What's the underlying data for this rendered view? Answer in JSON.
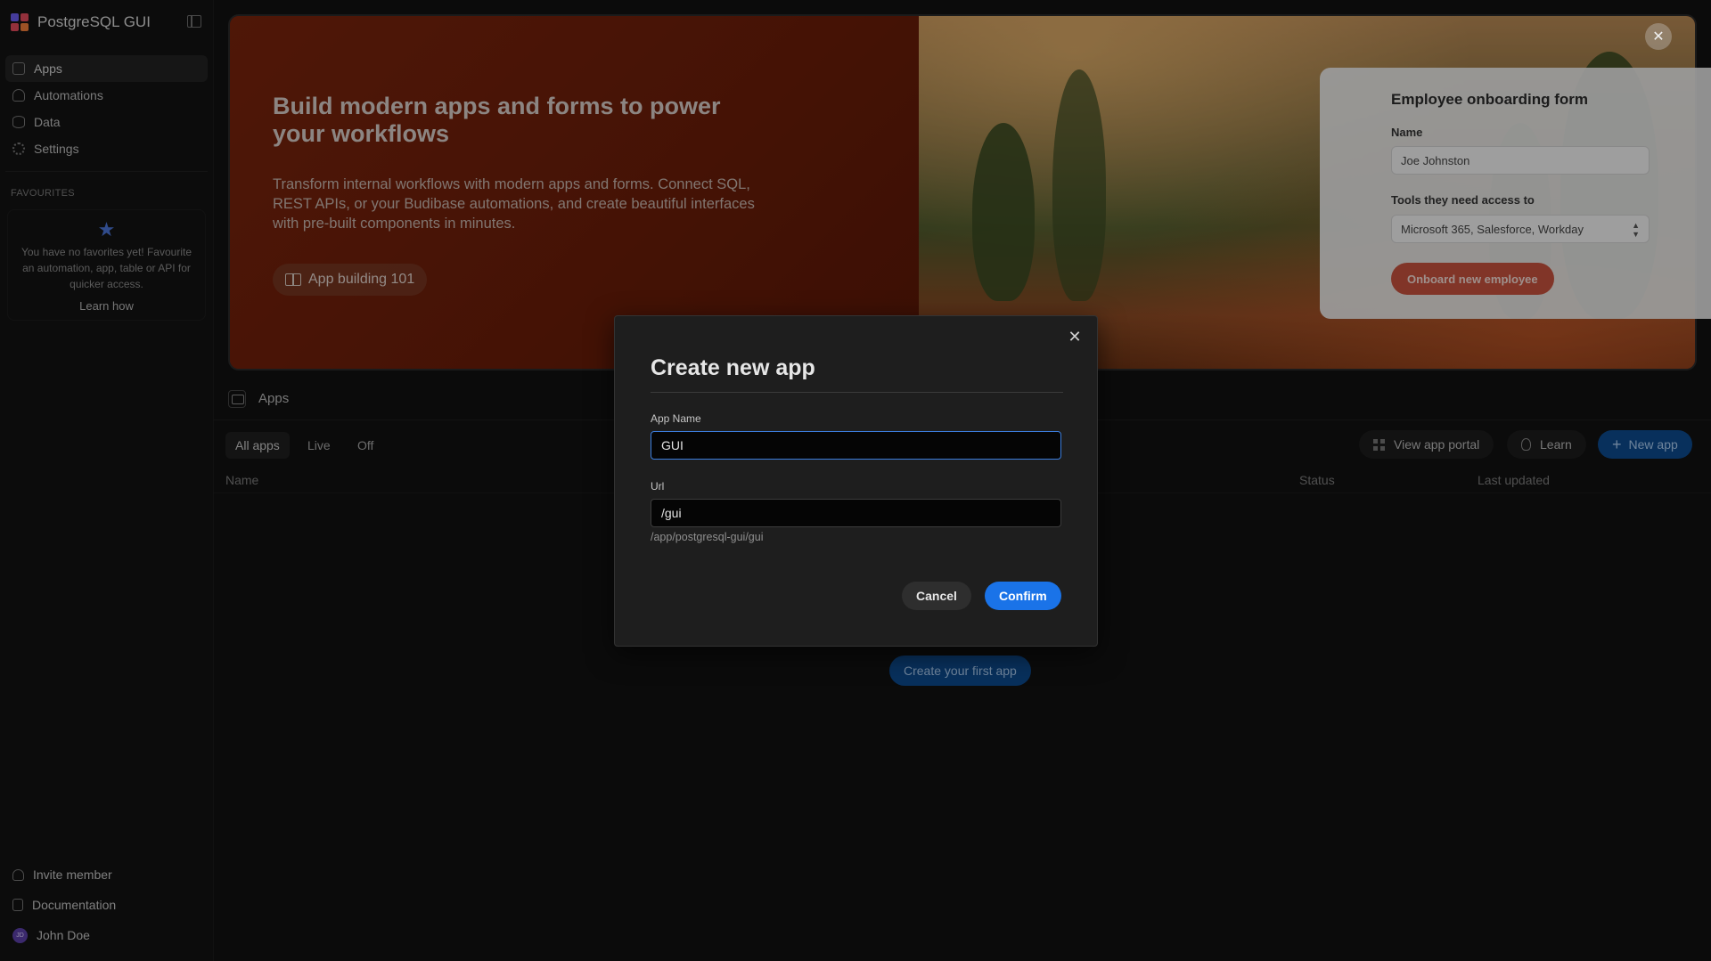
{
  "sidebar": {
    "title": "PostgreSQL GUI",
    "nav": [
      {
        "label": "Apps",
        "icon": "apps-icon"
      },
      {
        "label": "Automations",
        "icon": "automations-icon"
      },
      {
        "label": "Data",
        "icon": "database-icon"
      },
      {
        "label": "Settings",
        "icon": "gear-icon"
      }
    ],
    "favourites_heading": "FAVOURITES",
    "favourites_empty": "You have no favorites yet! Favourite an automation, app, table or API for quicker access.",
    "learn_how": "Learn how",
    "bottom": [
      {
        "label": "Invite member"
      },
      {
        "label": "Documentation"
      },
      {
        "label": "John Doe",
        "avatar": "JD"
      }
    ]
  },
  "hero": {
    "title": "Build modern apps and forms to power your workflows",
    "description": "Transform internal workflows with modern apps and forms. Connect SQL, REST APIs, or your Budibase automations, and create beautiful interfaces with pre-built components in minutes.",
    "button": "App building 101",
    "form": {
      "title": "Employee onboarding form",
      "name_label": "Name",
      "name_value": "Joe Johnston",
      "tools_label": "Tools they need access to",
      "tools_value": "Microsoft 365, Salesforce, Workday",
      "submit": "Onboard new employee"
    }
  },
  "apps": {
    "heading": "Apps",
    "tabs": [
      "All apps",
      "Live",
      "Off"
    ],
    "actions": {
      "portal": "View app portal",
      "learn": "Learn",
      "new": "New app"
    },
    "columns": [
      "Name",
      "Status",
      "Last updated"
    ],
    "empty_button": "Create your first app"
  },
  "modal": {
    "title": "Create new app",
    "app_name_label": "App Name",
    "app_name_value": "GUI",
    "url_label": "Url",
    "url_value": "/gui",
    "url_help": "/app/postgresql-gui/gui",
    "cancel": "Cancel",
    "confirm": "Confirm"
  },
  "colors": {
    "accent": "#1a73e8",
    "hero_bg": "#6d1f0b",
    "onboard_button": "#c6523e"
  }
}
